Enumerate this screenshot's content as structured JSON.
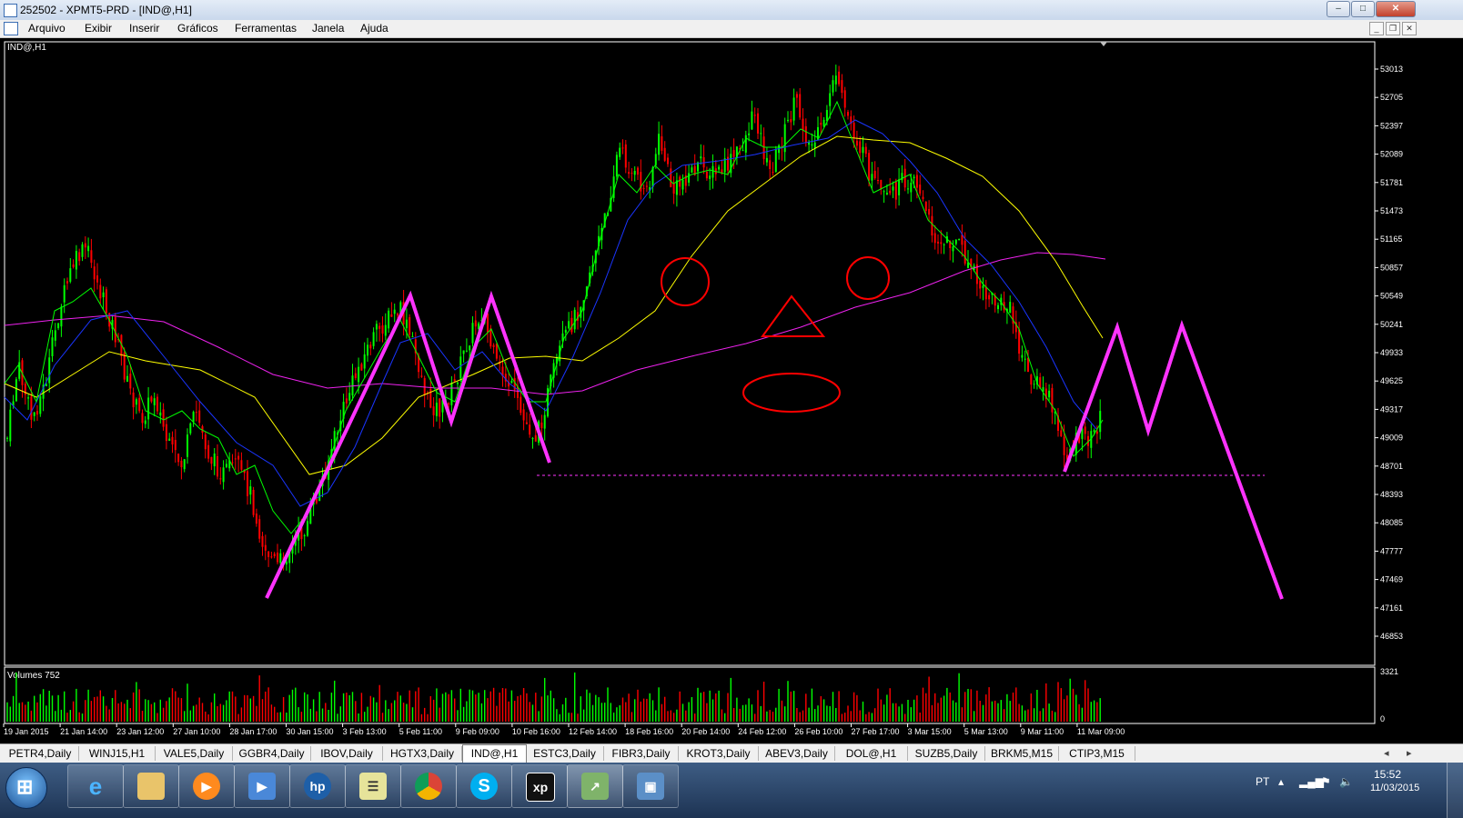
{
  "window": {
    "title": "252502 - XPMT5-PRD - [IND@,H1]",
    "min_label": "–",
    "max_label": "□",
    "close_label": "✕"
  },
  "menu": {
    "items": [
      "Arquivo",
      "Exibir",
      "Inserir",
      "Gráficos",
      "Ferramentas",
      "Janela",
      "Ajuda"
    ],
    "mdi_min": "_",
    "mdi_restore": "❐",
    "mdi_close": "✕"
  },
  "chart": {
    "symbol_label": "IND@,H1",
    "volumes_label": "Volumes 752",
    "price_ticks": [
      "53013",
      "52705",
      "52397",
      "52089",
      "51781",
      "51473",
      "51165",
      "50857",
      "50549",
      "50241",
      "49933",
      "49625",
      "49317",
      "49009",
      "48701",
      "48393",
      "48085",
      "47777",
      "47469",
      "47161",
      "46853"
    ],
    "volume_ticks": [
      "3321",
      "0"
    ],
    "time_labels": [
      "19 Jan 2015",
      "21 Jan 14:00",
      "23 Jan 12:00",
      "27 Jan 10:00",
      "28 Jan 17:00",
      "30 Jan 15:00",
      "3 Feb 13:00",
      "5 Feb 11:00",
      "9 Feb 09:00",
      "10 Feb 16:00",
      "12 Feb 14:00",
      "18 Feb 16:00",
      "20 Feb 14:00",
      "24 Feb 12:00",
      "26 Feb 10:00",
      "27 Feb 17:00",
      "3 Mar 15:00",
      "5 Mar 13:00",
      "9 Mar 11:00",
      "11 Mar 09:00"
    ],
    "colors": {
      "bull": "#00ff00",
      "bear": "#ff0000",
      "ma_fast": "#00ff00",
      "ma_blue": "#1a35ff",
      "ma_yellow": "#ffff00",
      "ma_magenta": "#ee22ee",
      "drawing_magenta": "#ff33ff",
      "drawing_red": "#ff0000",
      "axis_text": "#ffffff"
    }
  },
  "tabs": {
    "items": [
      "PETR4,Daily",
      "WINJ15,H1",
      "VALE5,Daily",
      "GGBR4,Daily",
      "IBOV,Daily",
      "HGTX3,Daily",
      "IND@,H1",
      "ESTC3,Daily",
      "FIBR3,Daily",
      "KROT3,Daily",
      "ABEV3,Daily",
      "DOL@,H1",
      "SUZB5,Daily",
      "BRKM5,M15",
      "CTIP3,M15"
    ],
    "active": "IND@,H1",
    "scroll_left": "◂",
    "scroll_right": "▸"
  },
  "taskbar": {
    "apps": [
      "internet-explorer-icon",
      "file-explorer-icon",
      "media-player-icon",
      "network-icon",
      "hp-icon",
      "notes-icon",
      "chrome-icon",
      "skype-icon",
      "xp-investimentos-icon",
      "metatrader-icon",
      "photo-viewer-icon"
    ],
    "xp_label": "xp",
    "hp_label": "hp",
    "language": "PT",
    "time": "15:52",
    "date": "11/03/2015"
  }
}
